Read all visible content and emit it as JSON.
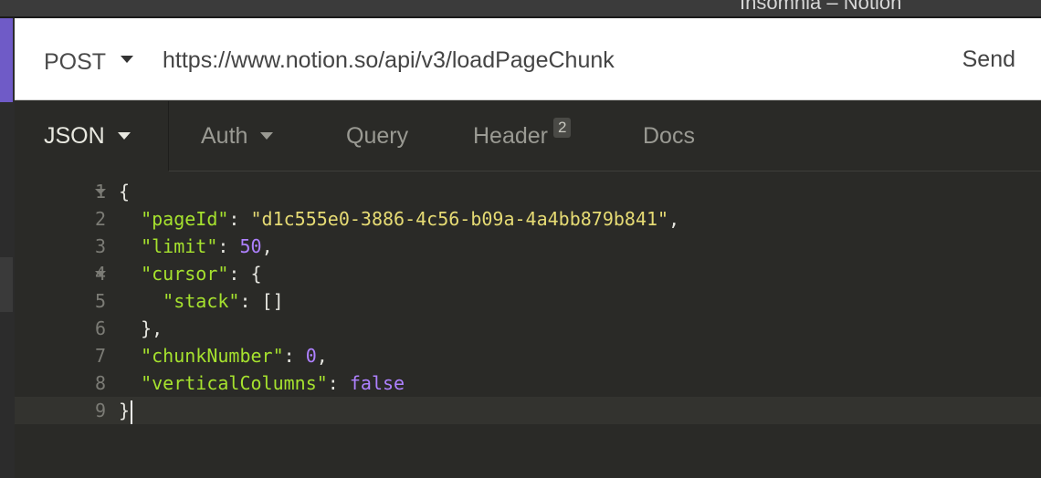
{
  "window": {
    "title": "Insomnia – Notion"
  },
  "request": {
    "method": "POST",
    "url": "https://www.notion.so/api/v3/loadPageChunk",
    "send_label": "Send"
  },
  "tabs": [
    {
      "label": "JSON",
      "active": true,
      "has_dropdown": true
    },
    {
      "label": "Auth",
      "active": false,
      "has_dropdown": true
    },
    {
      "label": "Query",
      "active": false
    },
    {
      "label": "Header",
      "active": false,
      "badge": "2"
    },
    {
      "label": "Docs",
      "active": false
    }
  ],
  "editor": {
    "line_numbers": [
      "1",
      "2",
      "3",
      "4",
      "5",
      "6",
      "7",
      "8",
      "9"
    ],
    "body": {
      "pageId": "d1c555e0-3886-4c56-b09a-4a4bb879b841",
      "limit": "50",
      "chunkNumber": "0",
      "verticalColumns": "false"
    },
    "keys": {
      "pageId": "\"pageId\"",
      "limit": "\"limit\"",
      "cursor": "\"cursor\"",
      "stack": "\"stack\"",
      "chunkNumber": "\"chunkNumber\"",
      "verticalColumns": "\"verticalColumns\""
    },
    "strings": {
      "pageId": "\"d1c555e0-3886-4c56-b09a-4a4bb879b841\""
    }
  },
  "colors": {
    "accent": "#6f5bc7",
    "json_key": "#a6e22e",
    "json_string": "#e6db74",
    "json_number": "#ae81ff"
  }
}
